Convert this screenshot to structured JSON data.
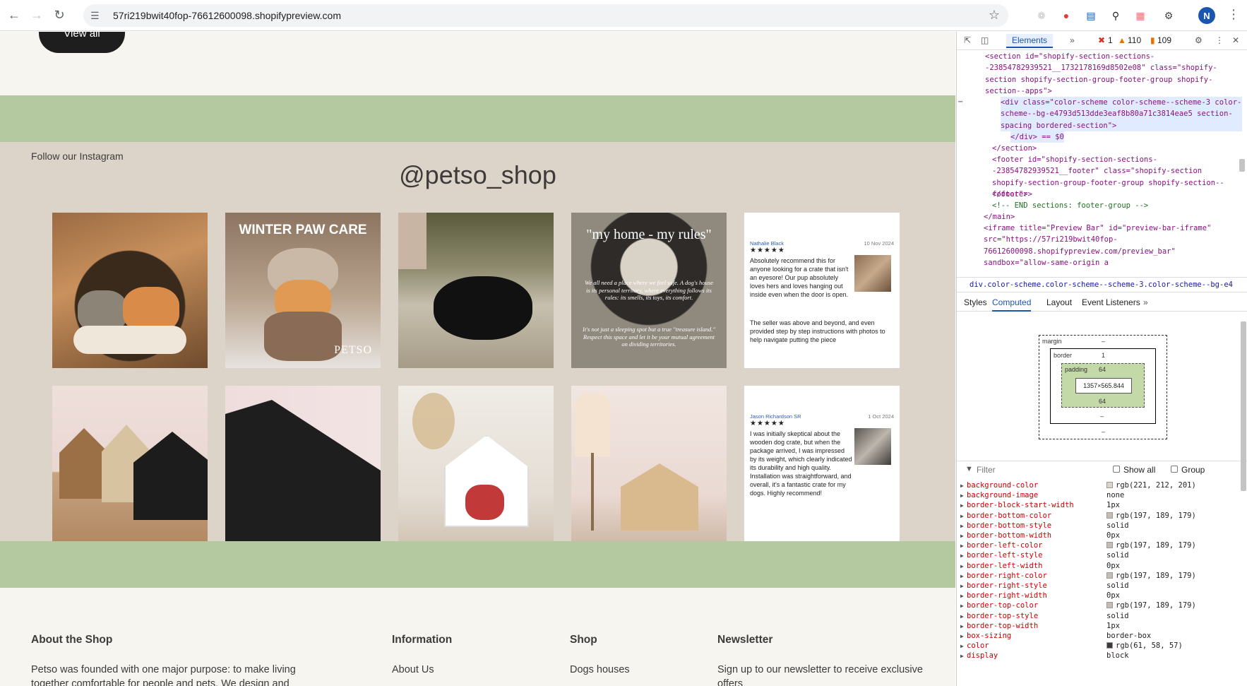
{
  "browser": {
    "url": "57ri219bwit40fop-76612600098.shopifypreview.com",
    "profile_initial": "N"
  },
  "page": {
    "view_all": "View all",
    "follow_label": "Follow our Instagram",
    "handle": "@petso_shop",
    "posts": [
      {
        "kind": "photo",
        "caption": ""
      },
      {
        "kind": "photo",
        "caption": "WINTER PAW CARE",
        "brand": "PETSO"
      },
      {
        "kind": "photo",
        "caption": ""
      },
      {
        "kind": "photo",
        "caption": "\"my home - my rules\"",
        "body": "We all need a place where we feel safe. A dog's house is its personal territory, where everything follows its rules: its smells, its toys, its comfort.",
        "body2": "It's not just a sleeping spot but a true \"treasure island.\" Respect this space and let it be your mutual agreement on dividing territories."
      },
      {
        "kind": "review",
        "name": "Nathalie Black",
        "date": "10 Nov 2024",
        "stars": "★★★★★",
        "text": "Absolutely recommend this for anyone looking for a crate that isn't an eyesore! Our pup absolutely loves hers and loves hanging out inside even when the door is open.",
        "text2": "The seller was above and beyond, and even provided step by step instructions with photos to help navigate putting the piece"
      },
      {
        "kind": "photo",
        "caption": ""
      },
      {
        "kind": "photo",
        "caption": ""
      },
      {
        "kind": "photo",
        "caption": ""
      },
      {
        "kind": "photo",
        "caption": ""
      },
      {
        "kind": "review",
        "name": "Jason Richardson SR",
        "date": "1 Oct 2024",
        "stars": "★★★★★",
        "text": "I was initially skeptical about the wooden dog crate, but when the package arrived, I was impressed by its weight, which clearly indicated its durability and high quality. Installation was straightforward, and overall, it's a fantastic crate for my dogs. Highly recommend!",
        "text2": ""
      }
    ],
    "footer": {
      "about_title": "About the Shop",
      "about_text": "Petso was founded with one major purpose: to make living together comfortable for people and pets. We design and",
      "info_title": "Information",
      "info_link": "About Us",
      "shop_title": "Shop",
      "shop_link": "Dogs houses",
      "news_title": "Newsletter",
      "news_text": "Sign up to our newsletter to receive exclusive offers"
    }
  },
  "devtools": {
    "tab_elements": "Elements",
    "errors": "1",
    "warnings": "110",
    "issues": "109",
    "breadcrumb": "div.color-scheme.color-scheme--scheme-3.color-scheme--bg-e4",
    "panel_tabs": [
      "Styles",
      "Computed",
      "Layout",
      "Event Listeners"
    ],
    "active_panel": "Computed",
    "box": {
      "margin": "margin",
      "margin_val": "–",
      "border": "border",
      "border_val": "1",
      "padding": "padding",
      "padding_val": "64",
      "content": "1357×565.844",
      "padding_bottom": "64",
      "dash": "–"
    },
    "filter_placeholder": "Filter",
    "show_all": "Show all",
    "group": "Group",
    "props": [
      {
        "name": "background-color",
        "value": "rgb(221, 212, 201)",
        "swatch": "#ddd4c9"
      },
      {
        "name": "background-image",
        "value": "none"
      },
      {
        "name": "border-block-start-width",
        "value": "1px"
      },
      {
        "name": "border-bottom-color",
        "value": "rgb(197, 189, 179)",
        "swatch": "#c5bdb3"
      },
      {
        "name": "border-bottom-style",
        "value": "solid"
      },
      {
        "name": "border-bottom-width",
        "value": "0px"
      },
      {
        "name": "border-left-color",
        "value": "rgb(197, 189, 179)",
        "swatch": "#c5bdb3"
      },
      {
        "name": "border-left-style",
        "value": "solid"
      },
      {
        "name": "border-left-width",
        "value": "0px"
      },
      {
        "name": "border-right-color",
        "value": "rgb(197, 189, 179)",
        "swatch": "#c5bdb3"
      },
      {
        "name": "border-right-style",
        "value": "solid"
      },
      {
        "name": "border-right-width",
        "value": "0px"
      },
      {
        "name": "border-top-color",
        "value": "rgb(197, 189, 179)",
        "swatch": "#c5bdb3"
      },
      {
        "name": "border-top-style",
        "value": "solid"
      },
      {
        "name": "border-top-width",
        "value": "1px"
      },
      {
        "name": "box-sizing",
        "value": "border-box"
      },
      {
        "name": "color",
        "value": "rgb(61, 58, 57)",
        "swatch": "#3d3a39"
      },
      {
        "name": "display",
        "value": "block"
      }
    ],
    "code": {
      "l1a": "<section id=\"shopify-section-sections--23854782939521__1732178169d8502e08\" class=\"shopify-section shopify-section-group-footer-group shopify-section--apps\">",
      "l2": "<div class=\"color-scheme color-scheme--scheme-3 color-scheme--bg-e4793d513dde3eaf8b80a71c3814eae5 section-spacing bordered-section\">",
      "l3": "</div> == $0",
      "l4": "</section>",
      "l5": "<footer id=\"shopify-section-sections--23854782939521__footer\" class=\"shopify-section shopify-section-group-footer-group shopify-section--footer\">",
      "l6": "</footer>",
      "l7": "<!-- END sections: footer-group -->",
      "l8": "</main>",
      "l9": "<iframe title=\"Preview Bar\" id=\"preview-bar-iframe\" src=\"https://57ri219bwit40fop-76612600098.shopifypreview.com/preview_bar\" sandbox=\"allow-same-origin a"
    }
  }
}
